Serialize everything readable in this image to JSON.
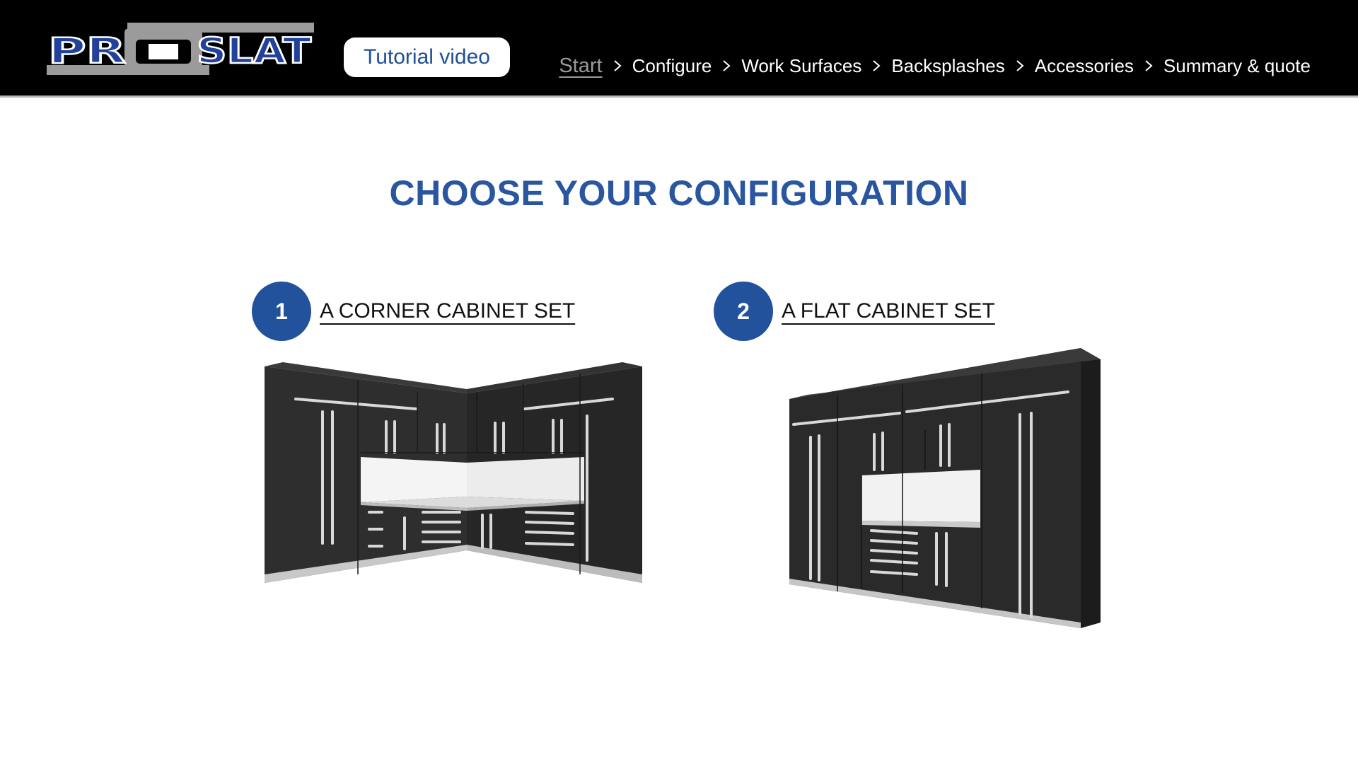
{
  "header": {
    "logo_text": "PROSLAT",
    "tutorial_label": "Tutorial video",
    "nav": [
      {
        "label": "Start",
        "active": true
      },
      {
        "label": "Configure",
        "active": false
      },
      {
        "label": "Work Surfaces",
        "active": false
      },
      {
        "label": "Backsplashes",
        "active": false
      },
      {
        "label": "Accessories",
        "active": false
      },
      {
        "label": "Summary & quote",
        "active": false
      }
    ],
    "separator_icon": "chevron-right-icon"
  },
  "main": {
    "title": "CHOOSE YOUR CONFIGURATION",
    "options": [
      {
        "number": "1",
        "label": "A CORNER CABINET SET",
        "image_icon": "corner-cabinet-set-image"
      },
      {
        "number": "2",
        "label": "A FLAT CABINET SET",
        "image_icon": "flat-cabinet-set-image"
      }
    ]
  },
  "colors": {
    "header_bg": "#000000",
    "brand_blue": "#21529b",
    "title_blue": "#2a56a0",
    "nav_active": "#9a9a9a",
    "cabinet": "#2b2b2b"
  }
}
